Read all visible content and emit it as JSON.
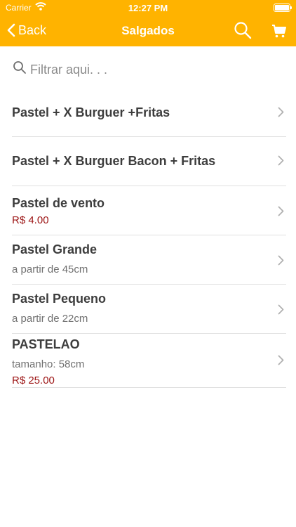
{
  "status": {
    "carrier": "Carrier",
    "time": "12:27 PM"
  },
  "nav": {
    "back_label": "Back",
    "title": "Salgados"
  },
  "filter": {
    "placeholder": "Filtrar aqui. . ."
  },
  "items": [
    {
      "name": "Pastel + X Burguer +Fritas"
    },
    {
      "name": "Pastel + X Burguer Bacon + Fritas"
    },
    {
      "name": "Pastel de vento",
      "price": "R$ 4.00"
    },
    {
      "name": "Pastel Grande",
      "sub": "a partir de 45cm"
    },
    {
      "name": "Pastel Pequeno",
      "sub": "a partir de 22cm"
    },
    {
      "name": "PASTELAO",
      "sub": "tamanho: 58cm",
      "price": "R$ 25.00"
    }
  ],
  "colors": {
    "accent": "#ffb300",
    "price": "#9c1414",
    "separator": "#e0e0e0"
  },
  "icons": [
    "wifi-icon",
    "battery-icon",
    "chevron-left-icon",
    "search-icon",
    "cart-icon",
    "chevron-right-icon"
  ]
}
